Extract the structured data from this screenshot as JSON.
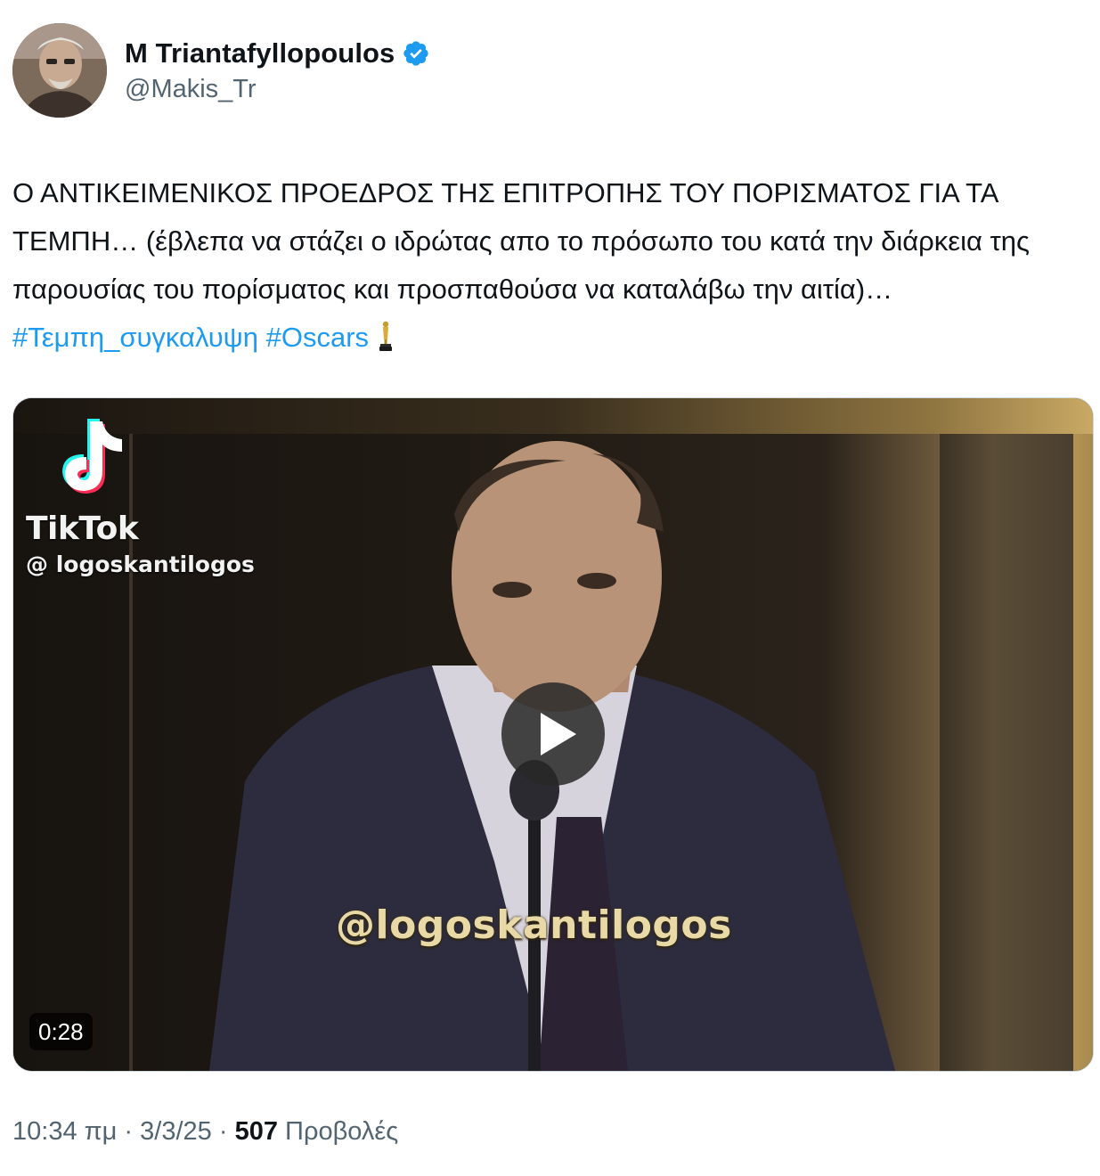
{
  "author": {
    "display_name": "M Triantafyllopoulos",
    "handle": "@Makis_Tr",
    "verified": true
  },
  "tweet": {
    "text_main": "Ο ΑΝΤΙΚΕΙΜΕΝΙΚΟΣ ΠΡΟΕΔΡΟΣ ΤΗΣ ΕΠΙΤΡΟΠΗΣ ΤΟΥ ΠΟΡΙΣΜΑΤΟΣ ΓΙΑ ΤΑ ΤΕΜΠΗ… (έβλεπα να στάζει ο ιδρώτας απο το πρόσωπο του κατά την διάρκεια της παρουσίας του πορίσματος και προσπαθούσα να καταλάβω την αιτία)… ",
    "hashtags": [
      "#Τεμπη_συγκαλυψη",
      "#Oscars"
    ],
    "emoji_icon": "oscar-trophy-icon"
  },
  "media": {
    "tiktok_brand": "TikTok",
    "tiktok_handle": "@ logoskantilogos",
    "watermark": "@logoskantilogos",
    "duration": "0:28"
  },
  "meta": {
    "time": "10:34 πμ",
    "separator": " · ",
    "date": "3/3/25",
    "views_count": "507",
    "views_label": " Προβολές"
  },
  "colors": {
    "text": "#0f1419",
    "secondary": "#536471",
    "link": "#1d9bf0",
    "verified": "#1d9bf0",
    "frame_gold": "#c9a964"
  }
}
